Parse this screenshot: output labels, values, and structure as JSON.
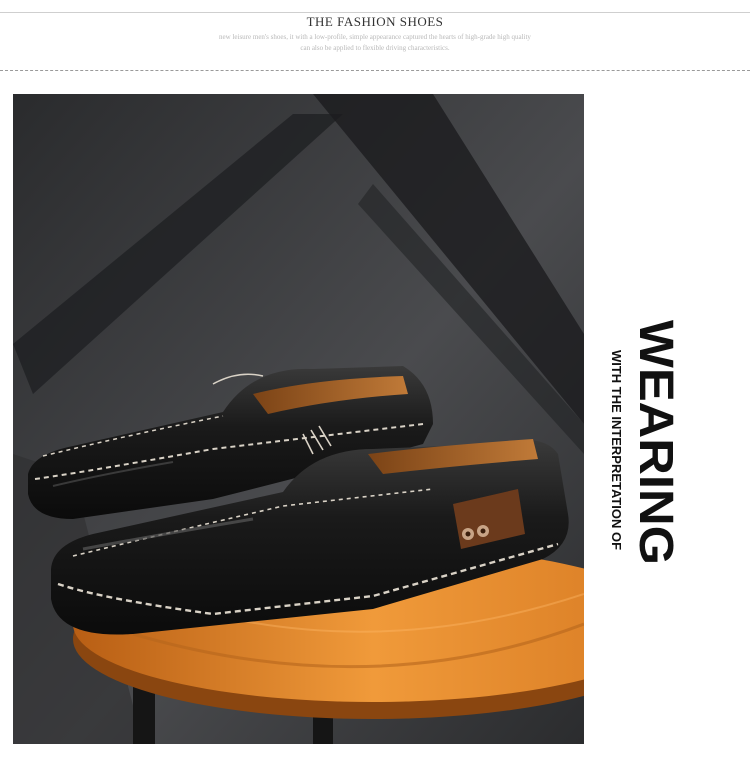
{
  "header": {
    "title": "THE FASHION SHOES",
    "subtitle_line1": "new leisure men's shoes, it with a low-profile, simple appearance captured the hearts of high-grade high quality",
    "subtitle_line2": "can also be applied to flexible driving characteristics."
  },
  "side_caption": {
    "main": "WEARING",
    "secondary": "WITH THE INTERPRETATION OF"
  },
  "colors": {
    "background": "#ffffff",
    "photo_backdrop": "#3c3d3f",
    "stool_wood": "#e38a2c",
    "shoe_leather": "#151515",
    "stitching": "#d9d2c6",
    "lining_tan": "#a8652a"
  }
}
